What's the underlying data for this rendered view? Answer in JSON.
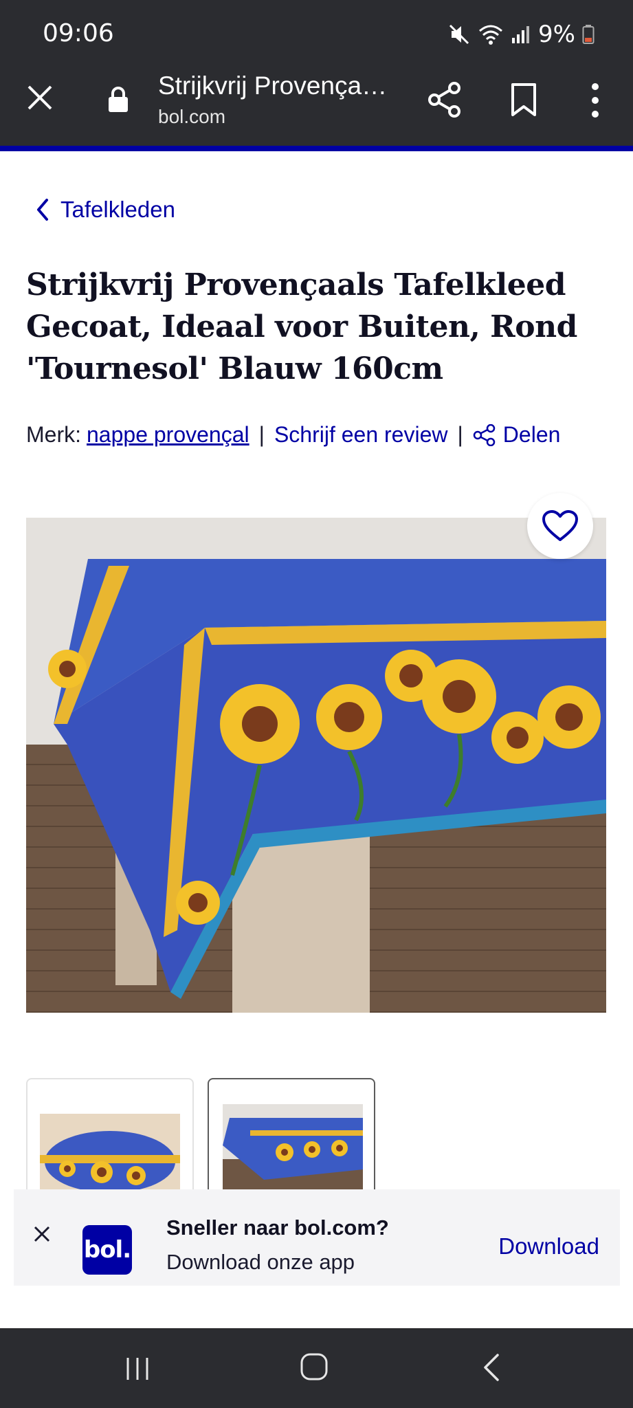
{
  "status": {
    "time": "09:06",
    "battery": "9%"
  },
  "browser": {
    "title": "Strijkvrij Provença…",
    "url": "bol.com"
  },
  "breadcrumb": {
    "label": "Tafelkleden"
  },
  "product": {
    "title_lines": [
      "Strijkvrij Provençaals Tafelkleed",
      "Gecoat, Ideaal voor Buiten, Rond",
      "'Tournesol' Blauw 160cm"
    ],
    "brand_label": "Merk:",
    "brand": "nappe provençal",
    "separator": "|",
    "review_link": "Schrijf een review",
    "share_label": "Delen"
  },
  "gallery": {
    "thumbnails": [
      "thumbnail-1",
      "thumbnail-2"
    ],
    "active_index": 1
  },
  "app_banner": {
    "logo_text": "bol.",
    "title": "Sneller naar bol.com?",
    "subtitle": "Download onze app",
    "download_label": "Download"
  },
  "colors": {
    "brand_blue": "#0000a4",
    "chrome_dark": "#2b2c30"
  }
}
